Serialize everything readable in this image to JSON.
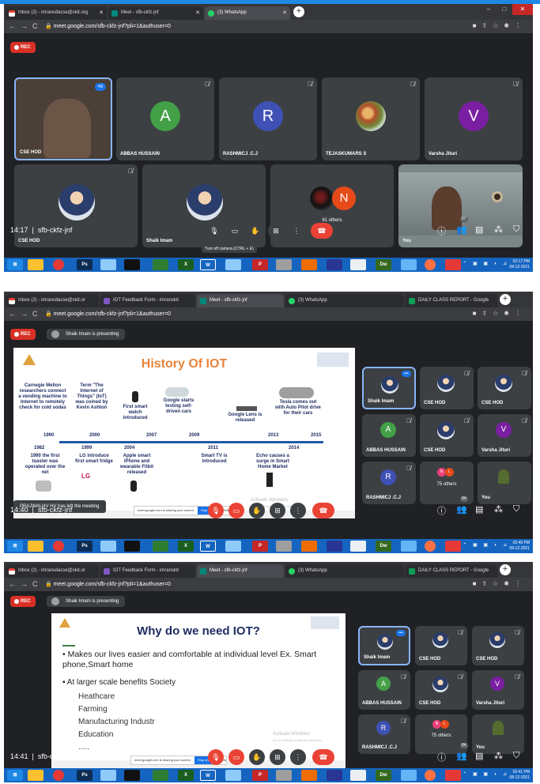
{
  "screens": [
    {
      "tabs": [
        {
          "label": "Inbox (2) - imranullacse@skit.org",
          "icon": "gmail-icon"
        },
        {
          "label": "Meet - sfb-ckfz-jnf",
          "icon": "meet-icon"
        },
        {
          "label": "(3) WhatsApp",
          "icon": "whatsapp-icon"
        }
      ],
      "url": "meet.google.com/sfb-ckfz-jnf?pli=1&authuser=0",
      "rec_label": "REC",
      "tiles": [
        {
          "name": "CSE HOD"
        },
        {
          "name": "ABBAS HUSSAIN",
          "initial": "A",
          "color": "#43a047"
        },
        {
          "name": "RASHMICJ .C.J",
          "initial": "R",
          "color": "#3f51b5"
        },
        {
          "name": "TEJASKUMARS S"
        },
        {
          "name": "Varsha Jituri",
          "initial": "V",
          "color": "#7b1fa2"
        },
        {
          "name": "CSE HOD"
        },
        {
          "name": "Shaik Imam"
        },
        {
          "name": "61 others",
          "initial": "N",
          "color": "#e64a19"
        },
        {
          "name": "You"
        }
      ],
      "tooltip": "Turn off camera (CTRL + E)",
      "time": "14:17",
      "meeting_code": "sfb-ckfz-jnf",
      "participants_count": "67",
      "clock_time": "02:17 PM",
      "clock_date": "08-12-2021"
    },
    {
      "tabs": [
        {
          "label": "Inbox (2) - imranullacse@skit.or",
          "icon": "gmail-icon"
        },
        {
          "label": "IOT Feedback Form - imranskit",
          "icon": "forms-icon"
        },
        {
          "label": "Meet - sfb-ckfz-jnf",
          "icon": "meet-icon"
        },
        {
          "label": "(3) WhatsApp",
          "icon": "whatsapp-icon"
        },
        {
          "label": "DAILY CLASS REPORT - Google",
          "icon": "sheets-icon"
        }
      ],
      "url": "meet.google.com/sfb-ckfz-jnf?pli=1&authuser=0",
      "rec_label": "REC",
      "presenting": "Shaik Imam is presenting",
      "slide": {
        "title": "History Of IOT",
        "events_top": [
          {
            "text": "Carnegie Mellon researchers connect a vending machine to Internet to remotely check for cold sodas",
            "year": "1990"
          },
          {
            "text": "Term \"The Internet of Things\" (IoT) was coined by Kevin Ashton",
            "year": "2000"
          },
          {
            "text": "First smart watch introduced",
            "year": "2007"
          },
          {
            "text": "Google starts testing self-driven cars",
            "year": "2009"
          },
          {
            "text": "Google Lens is released",
            "year": "2013"
          },
          {
            "text": "Tesla comes out with Auto Pilot drive for their cars",
            "year": "2015"
          }
        ],
        "events_bottom": [
          {
            "text": "1990 the first toaster was operated over the net",
            "year": "1982"
          },
          {
            "text": "LG introduce first smart fridge",
            "year": "1999"
          },
          {
            "text": "Apple smart iPhone and wearable Fitbit released",
            "year": "2004"
          },
          {
            "text": "Smart TV is introduced",
            "year": "2011"
          },
          {
            "text": "Echo causes a surge in Smart Home Market",
            "year": "2014"
          }
        ],
        "lg_logo": "LG"
      },
      "toast": "PRAJWALHV HV has left the meeting",
      "share_text": "meet.google.com is sharing your screen.",
      "stop_sharing": "Stop sharing",
      "hide": "Hide",
      "activate_title": "Activate Windows",
      "activate_sub": "Go to Settings to activate Windows.",
      "tiles": [
        {
          "name": "Shaik Imam"
        },
        {
          "name": "CSE HOD"
        },
        {
          "name": "CSE HOD"
        },
        {
          "name": "ABBAS HUSSAIN",
          "initial": "A",
          "color": "#43a047"
        },
        {
          "name": "CSE HOD"
        },
        {
          "name": "Varsha Jituri",
          "initial": "V",
          "color": "#7b1fa2"
        },
        {
          "name": "RASHMICJ .C.J",
          "initial": "R",
          "color": "#3f51b5"
        },
        {
          "name": "75 others"
        },
        {
          "name": "You"
        }
      ],
      "time": "14:40",
      "meeting_code": "sfb-ckfz-jnf",
      "participants_count": "84",
      "clock_time": "02:40 PM",
      "clock_date": "08-12-2021"
    },
    {
      "tabs": [
        {
          "label": "Inbox (2) - imranullacse@skit.or",
          "icon": "gmail-icon"
        },
        {
          "label": "IOT Feedback Form - imranskit",
          "icon": "forms-icon"
        },
        {
          "label": "Meet - sfb-ckfz-jnf",
          "icon": "meet-icon"
        },
        {
          "label": "(3) WhatsApp",
          "icon": "whatsapp-icon"
        },
        {
          "label": "DAILY CLASS REPORT - Google",
          "icon": "sheets-icon"
        }
      ],
      "url": "meet.google.com/sfb-ckfz-jnf?pli=1&authuser=0",
      "rec_label": "REC",
      "presenting": "Shaik Imam is presenting",
      "slide": {
        "title": "Why do we need IOT?",
        "bullet1": "Makes our lives easier and comfortable at individual level Ex. Smart phone,Smart home",
        "bullet2": "At larger scale benefits Society",
        "subitems": [
          "Heathcare",
          "Farming",
          "Manufacturing Industr",
          "Education"
        ],
        "ellipsis": "....."
      },
      "share_text": "meet.google.com is sharing your screen.",
      "stop_sharing": "Stop sharing",
      "hide": "Hide",
      "activate_title": "Activate Windows",
      "activate_sub": "Go to Settings to activate Windows.",
      "tiles": [
        {
          "name": "Shaik Imam"
        },
        {
          "name": "CSE HOD"
        },
        {
          "name": "CSE HOD"
        },
        {
          "name": "ABBAS HUSSAIN",
          "initial": "A",
          "color": "#43a047"
        },
        {
          "name": "CSE HOD"
        },
        {
          "name": "Varsha Jituri",
          "initial": "V",
          "color": "#7b1fa2"
        },
        {
          "name": "RASHMICJ .C.J",
          "initial": "R",
          "color": "#3f51b5"
        },
        {
          "name": "75 others"
        },
        {
          "name": "You"
        }
      ],
      "time": "14:41",
      "meeting_code": "sfb-ckfz-jnf",
      "participants_count": "84",
      "clock_time": "02:41 PM",
      "clock_date": "08-12-2021"
    }
  ],
  "taskbar_apps": [
    "start-icon",
    "file-explorer-icon",
    "chrome-icon",
    "photoshop-icon",
    "cmd-icon",
    "calculator-icon",
    "excel-icon",
    "word-icon",
    "powerpoint-icon",
    "dreamweaver-icon",
    "firefox-icon"
  ],
  "taskbar_labels": {
    "photoshop": "Ps",
    "excel": "X",
    "word": "W",
    "powerpoint": "P",
    "dreamweaver": "Dw"
  }
}
